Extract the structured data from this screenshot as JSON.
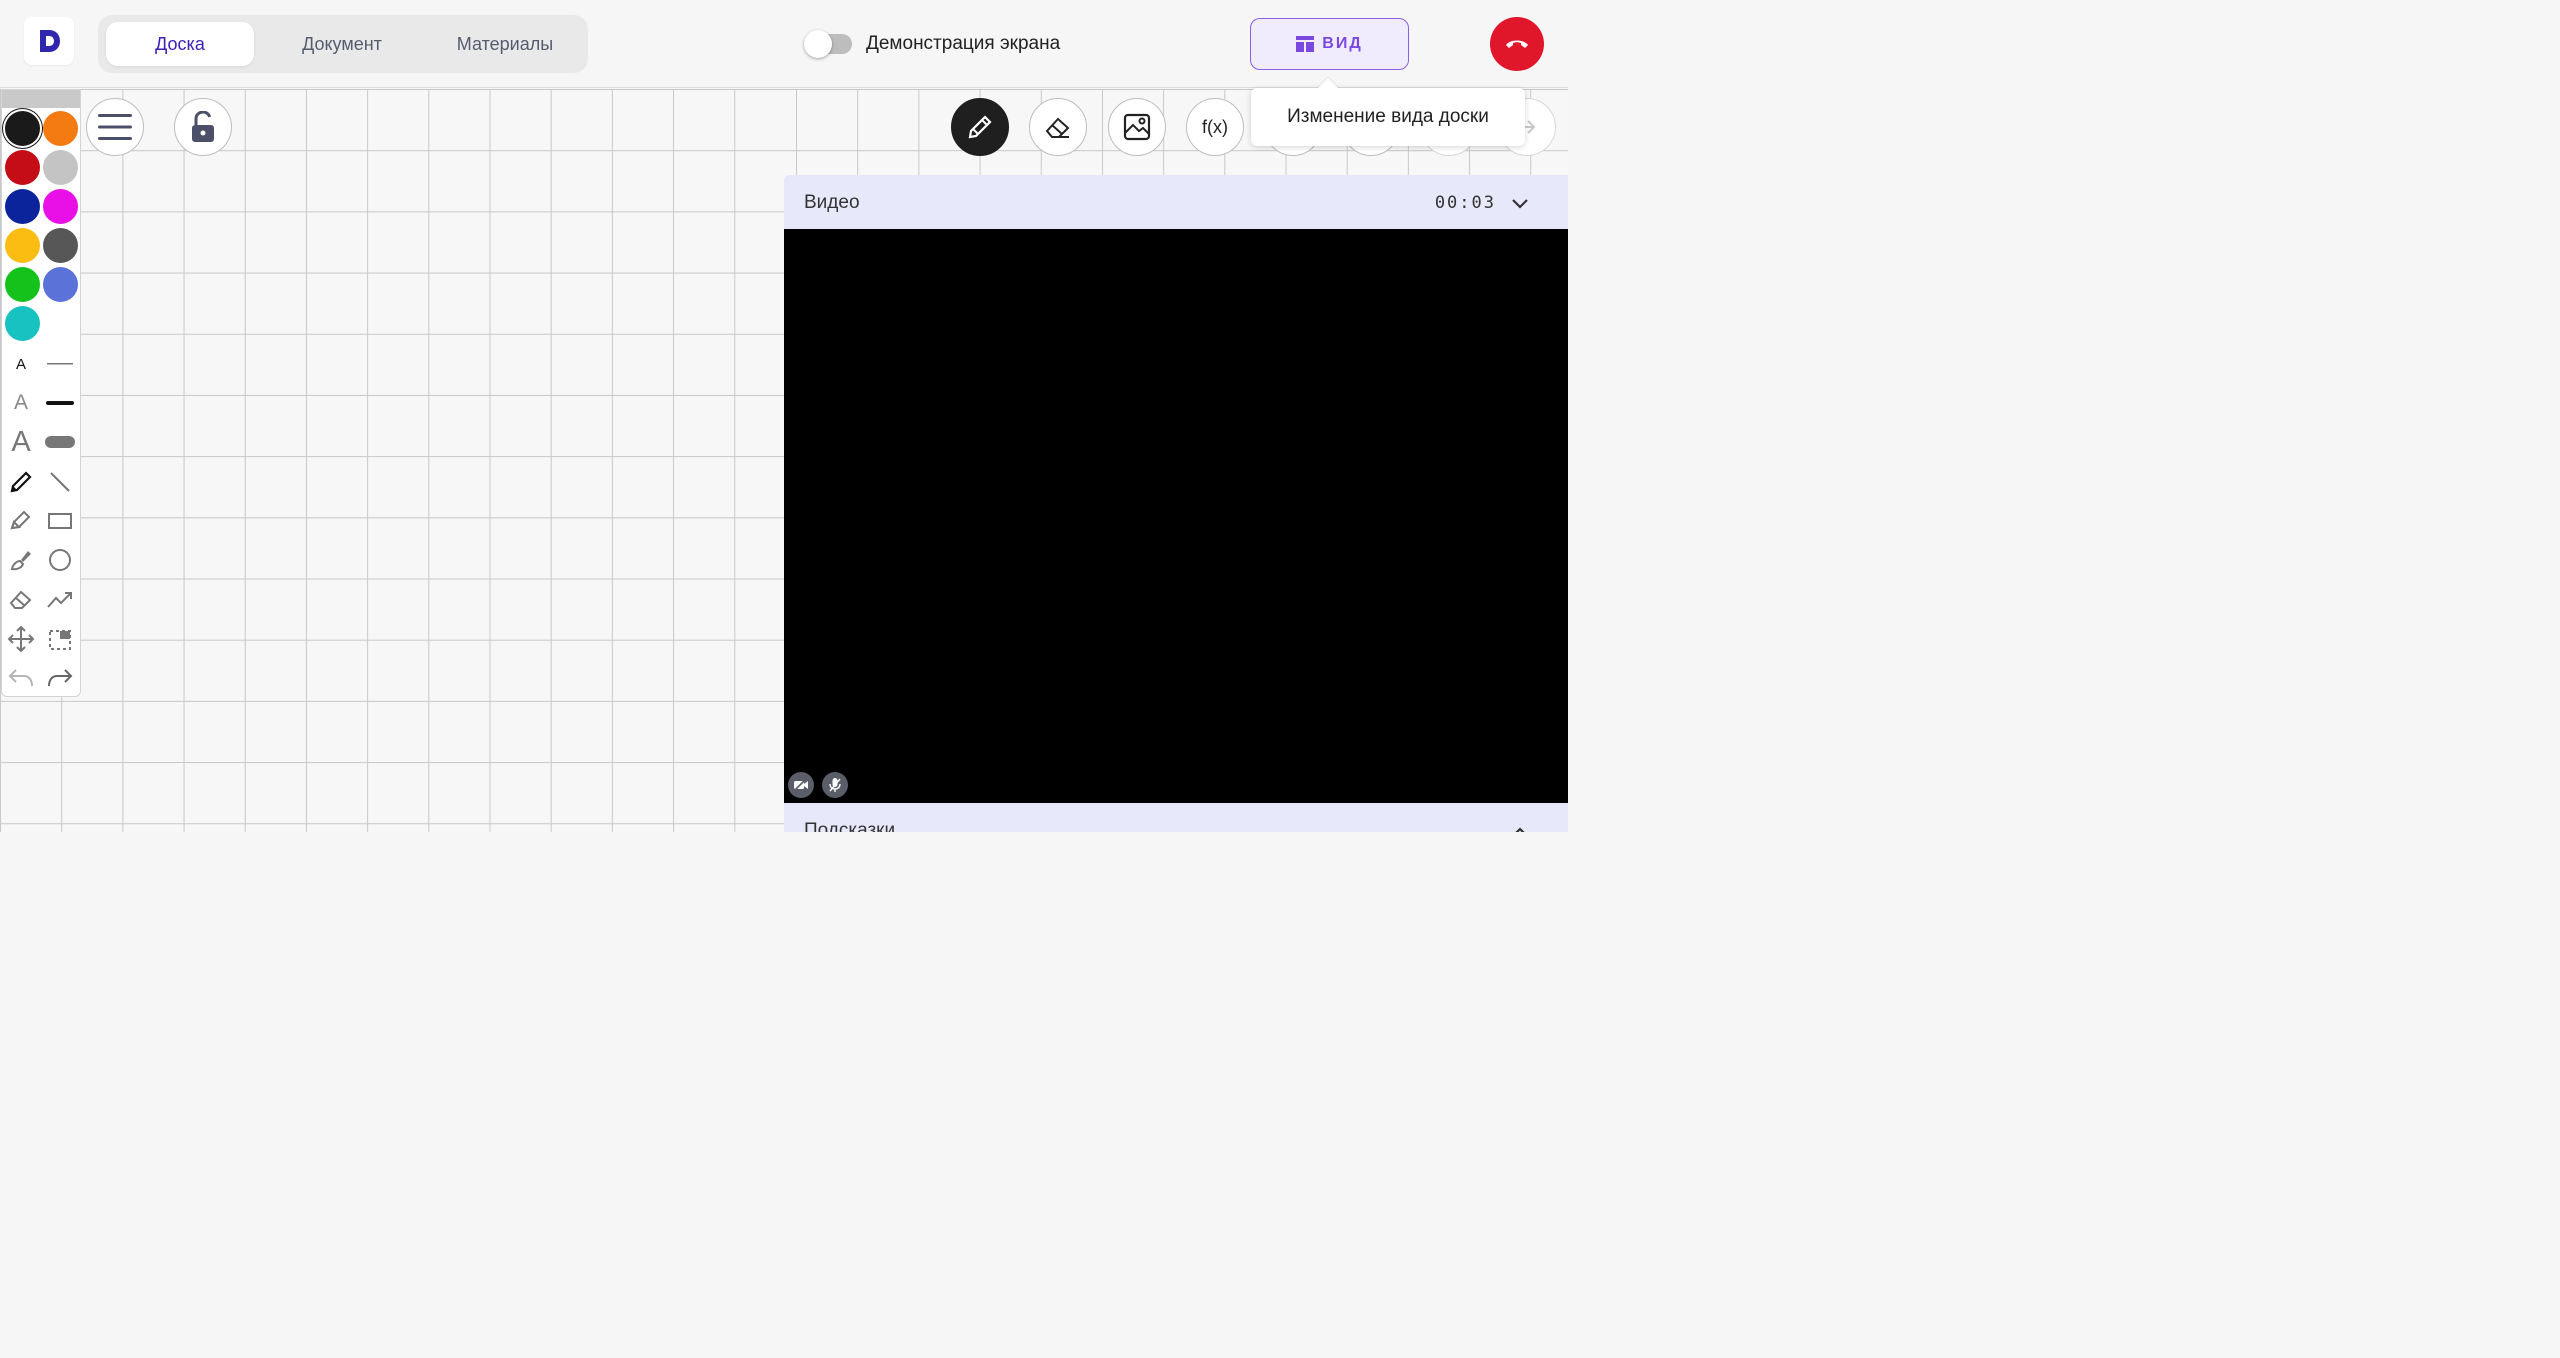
{
  "header": {
    "logo_letter": "D",
    "tabs": [
      {
        "label": "Доска",
        "active": true
      },
      {
        "label": "Документ",
        "active": false
      },
      {
        "label": "Материалы",
        "active": false
      }
    ],
    "screen_share_label": "Демонстрация экрана",
    "screen_share_on": false,
    "view_button_label": "ВИД",
    "end_call_icon": "phone-hangup-icon"
  },
  "tooltip": {
    "text": "Изменение вида доски"
  },
  "palette": {
    "colors": [
      "#1a1a1a",
      "#f47a12",
      "#c40d16",
      "#c4c4c4",
      "#0b249c",
      "#e810e6",
      "#fbbd12",
      "#575757",
      "#15c21c",
      "#5b73d8",
      "#18c2c1"
    ],
    "selected_color": "#1a1a1a",
    "text_size_label": "A"
  },
  "board_toolbar": {
    "fx_label": "f(x)"
  },
  "video": {
    "title": "Видео",
    "time": "00:03"
  },
  "hints": {
    "title": "Подсказки"
  },
  "colors": {
    "accent": "#7a48e0",
    "end_call": "#e0162b",
    "tab_active_text": "#3d1fb8",
    "panel_header": "#e8e8fb"
  }
}
